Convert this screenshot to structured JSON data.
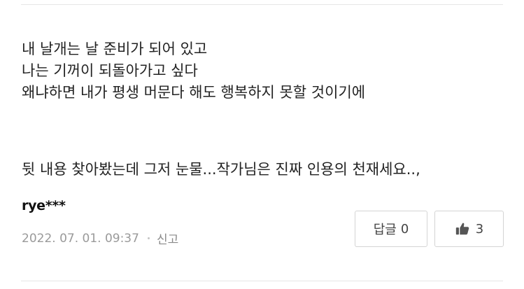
{
  "comment": {
    "lines": [
      "내 날개는 날 준비가 되어 있고",
      "나는 기꺼이 되돌아가고 싶다",
      "왜냐하면 내가 평생 머문다 해도 행복하지 못할 것이기에",
      "",
      "뒷 내용 찾아봤는데 그저 눈물...작가님은 진짜 인용의 천재세요..,"
    ]
  },
  "author": {
    "name": "rye***"
  },
  "meta": {
    "timestamp": "2022. 07. 01. 09:37",
    "report_label": "신고"
  },
  "actions": {
    "reply_label": "답글",
    "reply_count": "0",
    "like_count": "3",
    "like_icon": "thumbs-up-icon"
  },
  "colors": {
    "text": "#222222",
    "muted": "#9a9a9a",
    "border": "#d4d4d4",
    "divider": "#e6e6e6",
    "icon": "#555555"
  }
}
